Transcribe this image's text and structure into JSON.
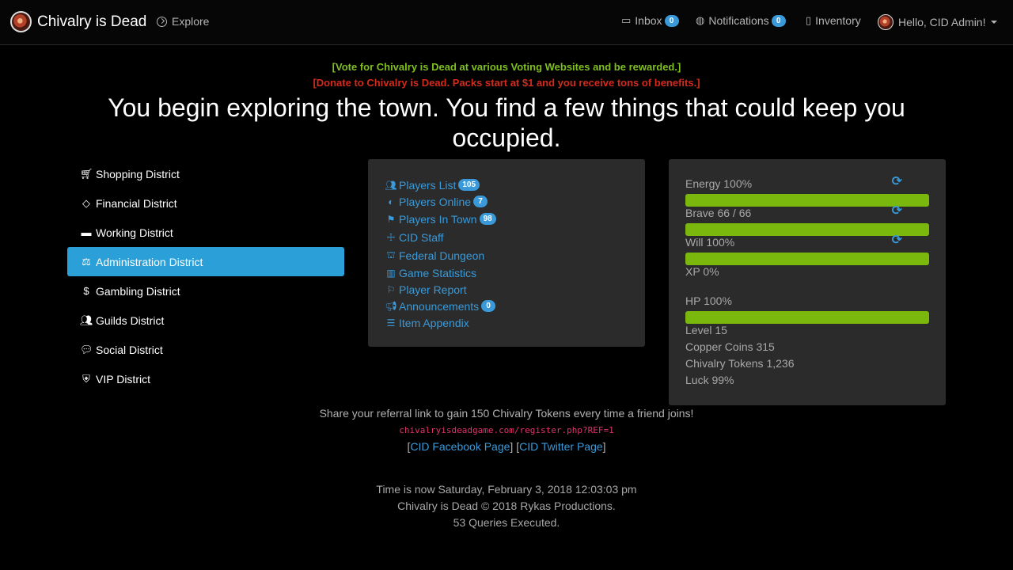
{
  "navbar": {
    "brand": "Chivalry is Dead",
    "explore": "Explore",
    "inbox_label": "Inbox",
    "inbox_count": "0",
    "notifications_label": "Notifications",
    "notifications_count": "0",
    "inventory_label": "Inventory",
    "user_greeting": "Hello, CID Admin!"
  },
  "announcements": {
    "vote": "[Vote for Chivalry is Dead at various Voting Websites and be rewarded.]",
    "donate": "[Donate to Chivalry is Dead. Packs start at $1 and you receive tons of benefits.]"
  },
  "headline": "You begin exploring the town. You find a few things that could keep you occupied.",
  "districts": [
    {
      "label": "Shopping District",
      "icon": "cart-icon"
    },
    {
      "label": "Financial District",
      "icon": "diamond-icon"
    },
    {
      "label": "Working District",
      "icon": "briefcase-icon"
    },
    {
      "label": "Administration District",
      "icon": "balance-scale-icon",
      "active": true
    },
    {
      "label": "Gambling District",
      "icon": "dollar-icon"
    },
    {
      "label": "Guilds District",
      "icon": "users-icon"
    },
    {
      "label": "Social District",
      "icon": "comments-icon"
    },
    {
      "label": "VIP District",
      "icon": "shield-icon"
    }
  ],
  "links": [
    {
      "label": "Players List",
      "badge": "105",
      "icon": "users-icon"
    },
    {
      "label": "Players Online",
      "badge": "7",
      "icon": "toggle-icon"
    },
    {
      "label": "Players In Town",
      "badge": "98",
      "icon": "town-icon"
    },
    {
      "label": "CID Staff",
      "icon": "staff-icon"
    },
    {
      "label": "Federal Dungeon",
      "icon": "dungeon-icon"
    },
    {
      "label": "Game Statistics",
      "icon": "bar-chart-icon"
    },
    {
      "label": "Player Report",
      "icon": "flag-icon"
    },
    {
      "label": "Announcements",
      "badge": "0",
      "icon": "bullhorn-icon"
    },
    {
      "label": "Item Appendix",
      "icon": "list-icon"
    }
  ],
  "stats": {
    "energy": {
      "label": "Energy 100%",
      "fill": 1.0
    },
    "brave": {
      "label": "Brave 66 / 66",
      "fill": 1.0
    },
    "will": {
      "label": "Will 100%",
      "fill": 1.0
    },
    "xp": {
      "label": "XP 0%",
      "fill": 0.0
    },
    "hp": {
      "label": "HP 100%",
      "fill": 1.0
    },
    "level": "Level 15",
    "copper": "Copper Coins 315",
    "tokens": "Chivalry Tokens 1,236",
    "luck": "Luck 99%"
  },
  "footer": {
    "referral": "Share your referral link to gain 150 Chivalry Tokens every time a friend joins!",
    "referral_link": "chivalryisdeadgame.com/register.php?REF=1",
    "facebook": "CID Facebook Page",
    "twitter": "CID Twitter Page",
    "time": "Time is now Saturday, February 3, 2018 12:03:03 pm",
    "copyright": "Chivalry is Dead © 2018 Rykas Productions.",
    "queries": "53 Queries Executed."
  },
  "colors": {
    "accent": "#2a9fd8",
    "link": "#3a9ad9",
    "bar": "#7ab80e",
    "vote": "#7fbf1e",
    "donate": "#d42a1b"
  }
}
